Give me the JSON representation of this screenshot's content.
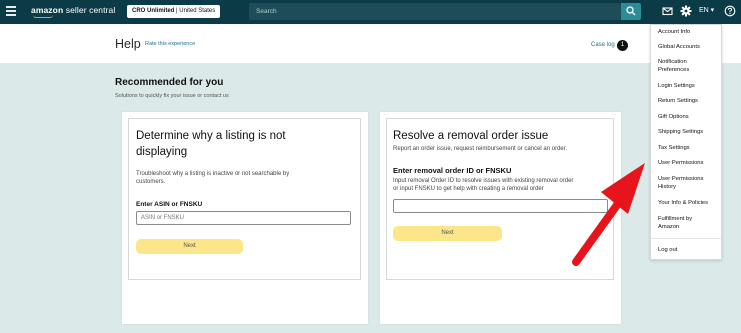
{
  "topbar": {
    "logo_main": "amazon",
    "logo_sub": "seller central",
    "store_name": "CRO Unlimited",
    "store_region": "| United States",
    "search_placeholder": "Search",
    "lang": "EN ▾",
    "colors": {
      "bar": "#0b3b46",
      "search_btn": "#2c8c97",
      "accent": "#ff9900"
    }
  },
  "help": {
    "title": "Help",
    "rate_link": "Rate this experience",
    "case_log": "Case log",
    "case_count": "1"
  },
  "recommended": {
    "title": "Recommended for you",
    "subtitle": "Solutions to quickly fix your issue or contact us"
  },
  "cards": [
    {
      "title_line1": "Determine why a listing is not",
      "title_line2": "displaying",
      "desc_line1": "Troubleshoot why a listing is inactive or not searchable by",
      "desc_line2": "customers.",
      "field_label": "Enter ASIN or FNSKU",
      "placeholder": "ASIN or FNSKU",
      "button": "Next"
    },
    {
      "title_line1": "Resolve a removal order issue",
      "desc_line1": "Report an order issue, request reimbursement or cancel an order.",
      "field_label": "Enter removal order ID or FNSKU",
      "field_desc_line1": "Input removal Order ID to resolve issues with existing removal order",
      "field_desc_line2": "or input FNSKU to get help with creating a removal order",
      "placeholder": "",
      "button": "Next"
    }
  ],
  "menu": {
    "items": [
      "Account Info",
      "Global Accounts",
      "Notification",
      "Preferences",
      "Login Settings",
      "Return Settings",
      "Gift Options",
      "Shipping Settings",
      "Tax Settings",
      "User Permissions",
      "User Permissions",
      "History",
      "Your Info & Policies",
      "Fulfillment by",
      "Amazon",
      "Log out"
    ]
  },
  "icons": {
    "menu": "hamburger-icon",
    "search": "search-icon",
    "mail": "mail-icon",
    "settings": "gear-icon",
    "help": "help-icon",
    "annotation": "red-arrow-icon"
  }
}
